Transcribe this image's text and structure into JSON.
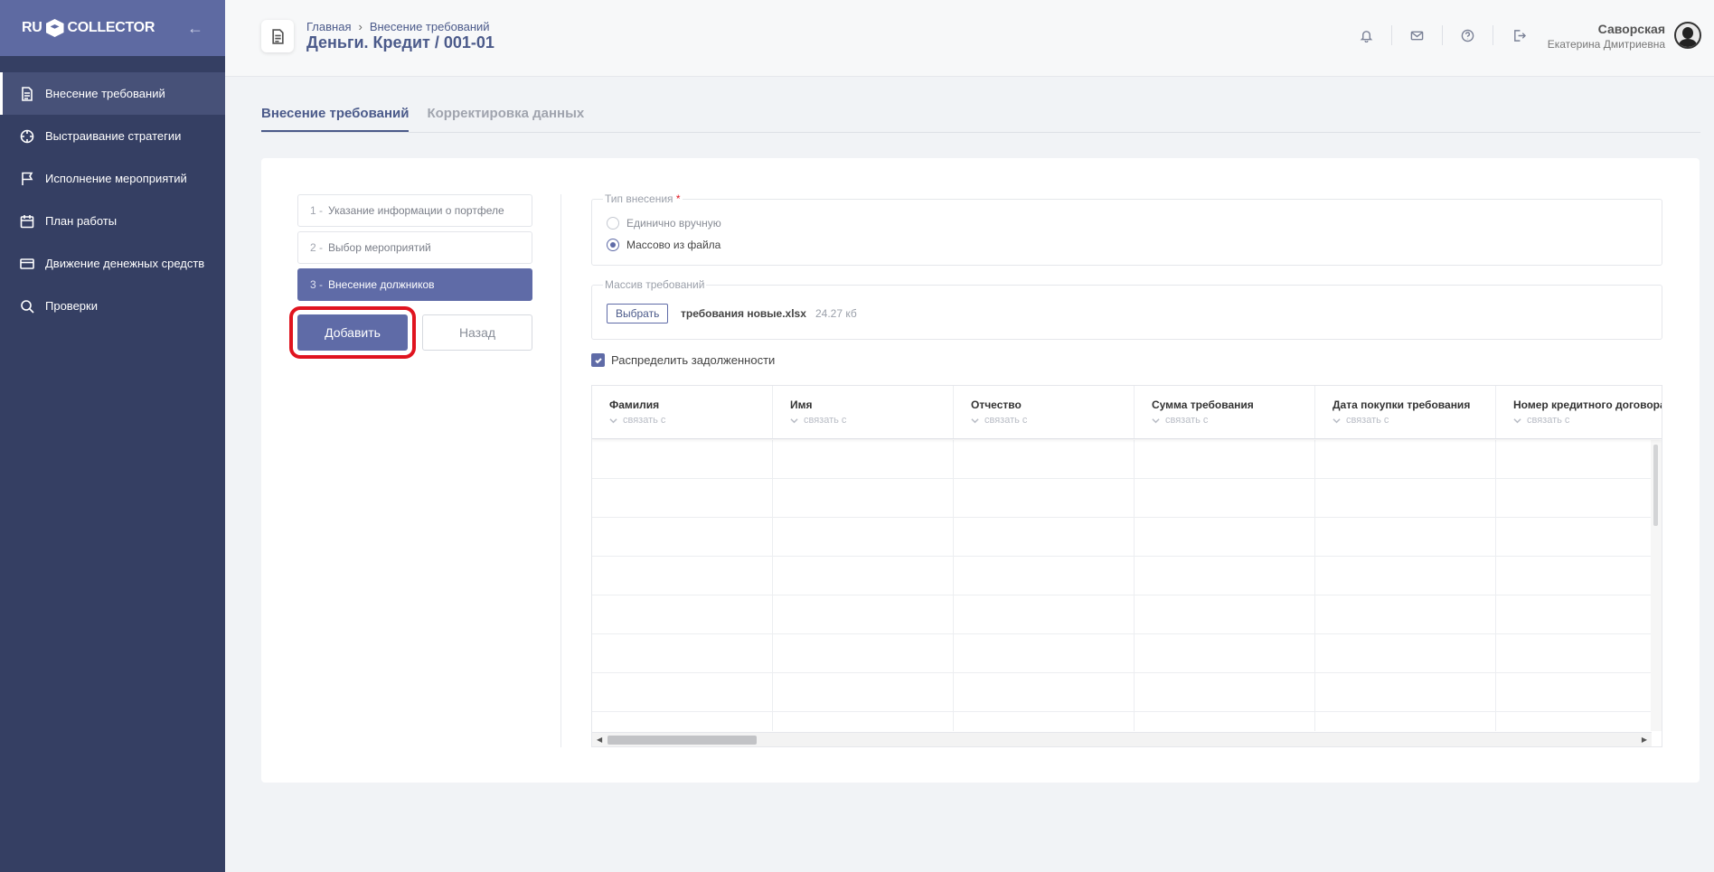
{
  "app": {
    "logo_left": "RU",
    "logo_right": "COLLECTOR"
  },
  "sidebar": {
    "items": [
      {
        "label": "Внесение требований",
        "icon": "document-icon",
        "active": true
      },
      {
        "label": "Выстраивание стратегии",
        "icon": "crosshair-icon",
        "active": false
      },
      {
        "label": "Исполнение мероприятий",
        "icon": "flag-icon",
        "active": false
      },
      {
        "label": "План работы",
        "icon": "calendar-icon",
        "active": false
      },
      {
        "label": "Движение денежных средств",
        "icon": "credit-card-icon",
        "active": false
      },
      {
        "label": "Проверки",
        "icon": "search-icon",
        "active": false
      }
    ]
  },
  "header": {
    "breadcrumb": [
      "Главная",
      "Внесение требований"
    ],
    "breadcrumb_sep": "›",
    "title": "Деньги. Кредит / 001-01",
    "user": {
      "last_name": "Саворская",
      "first_name": "Екатерина Дмитриевна"
    },
    "icons": [
      "bell-icon",
      "mail-icon",
      "help-icon",
      "logout-icon"
    ]
  },
  "tabs": [
    {
      "label": "Внесение требований",
      "active": true
    },
    {
      "label": "Корректировка данных",
      "active": false
    }
  ],
  "steps": [
    {
      "num": "1 -",
      "label": "Указание информации о портфеле",
      "active": false
    },
    {
      "num": "2 -",
      "label": "Выбор мероприятий",
      "active": false
    },
    {
      "num": "3 -",
      "label": "Внесение должников",
      "active": true
    }
  ],
  "buttons": {
    "add": "Добавить",
    "back": "Назад"
  },
  "form": {
    "type_legend": "Тип внесения",
    "required_mark": "*",
    "options": [
      {
        "label": "Единично вручную",
        "checked": false
      },
      {
        "label": "Массово из файла",
        "checked": true
      }
    ],
    "file_legend": "Массив требований",
    "choose_button": "Выбрать",
    "file_name": "требования новые.xlsx",
    "file_size": "24.27 кб",
    "distribute_label": "Распределить задолженности",
    "distribute_checked": true
  },
  "table": {
    "link_text": "связать с",
    "columns": [
      "Фамилия",
      "Имя",
      "Отчество",
      "Сумма требования",
      "Дата покупки требования",
      "Номер кредитного договора"
    ]
  },
  "colors": {
    "sidebar_bg": "#353f63",
    "accent": "#5f6ba7",
    "highlight": "#e0141f"
  }
}
